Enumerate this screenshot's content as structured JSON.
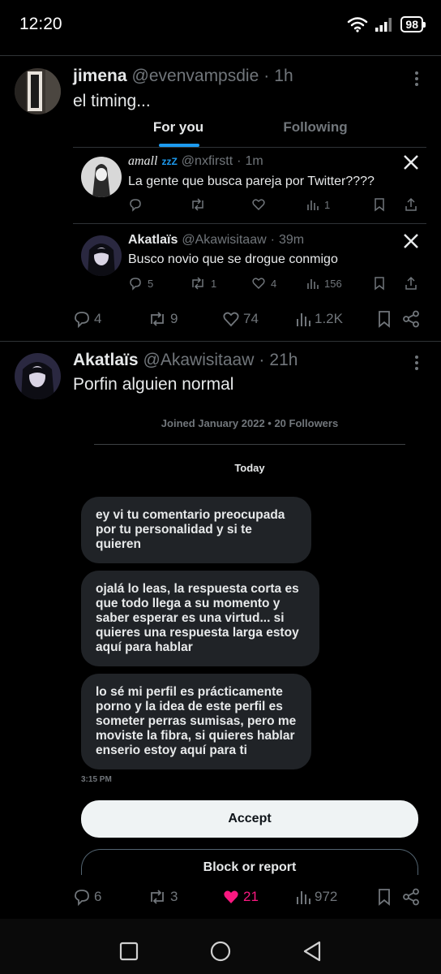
{
  "status_bar": {
    "time": "12:20",
    "battery": "98"
  },
  "feed_tabs": {
    "for_you": "For you",
    "following": "Following"
  },
  "tweet1": {
    "name": "jimena",
    "handle": "@evenvampsdie",
    "dot": "·",
    "age": "1h",
    "text": "el timing...",
    "quoted": [
      {
        "name": "amall",
        "name_suffix": "zzZ",
        "handle": "@nxfirstt",
        "dot": "·",
        "age": "1m",
        "text": "La gente que busca pareja por Twitter????",
        "replies": "",
        "reposts": "",
        "likes": "",
        "views": "1"
      },
      {
        "name": "Akatlaïs",
        "handle": "@Akawisitaaw",
        "dot": "·",
        "age": "39m",
        "text": "Busco novio que se drogue conmigo",
        "replies": "5",
        "reposts": "1",
        "likes": "4",
        "views": "156"
      }
    ],
    "replies": "4",
    "reposts": "9",
    "likes": "74",
    "views": "1.2K"
  },
  "tweet2": {
    "name": "Akatlaïs",
    "handle": "@Akawisitaaw",
    "dot": "·",
    "age": "21h",
    "text": "Porfin alguien normal",
    "dm": {
      "meta": "Joined January 2022 • 20 Followers",
      "day": "Today",
      "messages": [
        "ey vi tu comentario preocupada por tu personalidad y si te quieren",
        "ojalá lo leas, la respuesta corta es que todo llega a su momento y saber esperar es una virtud... si quieres una respuesta larga estoy aquí para hablar",
        "lo sé mi perfil es prácticamente porno y la idea de este perfil es someter perras sumisas, pero me moviste la fibra, si quieres hablar enserio estoy aquí para ti"
      ],
      "time": "3:15 PM",
      "accept_label": "Accept",
      "block_label": "Block or report"
    },
    "replies": "6",
    "reposts": "3",
    "likes": "21",
    "views": "972"
  },
  "colors": {
    "background": "#000000",
    "text": "#e7e9ea",
    "secondary": "#71767b",
    "accent": "#1d9bf0",
    "like_active": "#f91880",
    "bubble": "#202327"
  }
}
